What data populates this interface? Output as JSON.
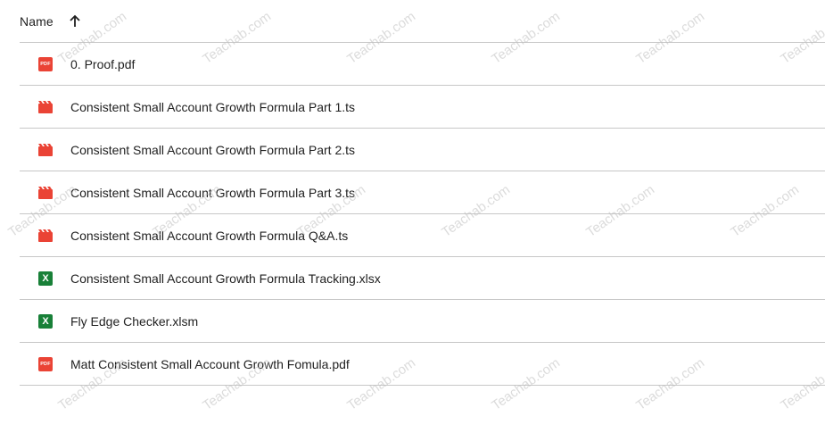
{
  "header": {
    "name_label": "Name",
    "sort_icon": "arrow-upward-icon"
  },
  "files": [
    {
      "name": "0. Proof.pdf",
      "type": "pdf",
      "icon": "pdf-icon"
    },
    {
      "name": "Consistent Small Account Growth Formula Part 1.ts",
      "type": "video",
      "icon": "video-icon"
    },
    {
      "name": "Consistent Small Account Growth Formula Part 2.ts",
      "type": "video",
      "icon": "video-icon"
    },
    {
      "name": "Consistent Small Account Growth Formula Part 3.ts",
      "type": "video",
      "icon": "video-icon"
    },
    {
      "name": "Consistent Small Account Growth Formula Q&A.ts",
      "type": "video",
      "icon": "video-icon"
    },
    {
      "name": "Consistent Small Account Growth Formula Tracking.xlsx",
      "type": "excel",
      "icon": "excel-icon"
    },
    {
      "name": "Fly Edge Checker.xlsm",
      "type": "excel",
      "icon": "excel-icon"
    },
    {
      "name": "Matt Consistent Small Account Growth Fomula.pdf",
      "type": "pdf",
      "icon": "pdf-icon"
    }
  ],
  "icon_text": {
    "pdf": "PDF",
    "excel": "X"
  },
  "watermark_text": "Teachab.com",
  "colors": {
    "pdf": "#ea4335",
    "video": "#ea4335",
    "excel": "#188038",
    "divider": "#c7c7c7"
  }
}
